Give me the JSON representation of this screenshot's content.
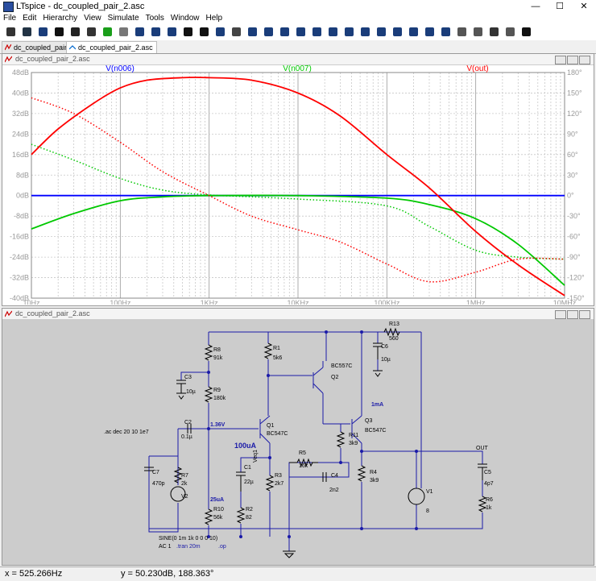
{
  "window": {
    "title": "LTspice - dc_coupled_pair_2.asc",
    "minimize": "—",
    "maximize": "☐",
    "close": "✕"
  },
  "menu": [
    "File",
    "Edit",
    "Hierarchy",
    "View",
    "Simulate",
    "Tools",
    "Window",
    "Help"
  ],
  "toolbar_icons": [
    "settings-icon",
    "open-icon",
    "open-file-icon",
    "save-icon",
    "print-icon",
    "control-panel-icon",
    "run-icon",
    "halt-icon",
    "new-schematic-icon",
    "new-symbol-icon",
    "tile-icon",
    "zoom-in-icon",
    "zoom-out-icon",
    "zoom-fit-icon",
    "autoscale-icon",
    "wire-icon",
    "ground-icon",
    "label-icon",
    "resistor-icon",
    "capacitor-icon",
    "inductor-icon",
    "diode-icon",
    "net-icon",
    "text-icon",
    "spice-directive-icon",
    "move-icon",
    "drag-icon",
    "copy-icon",
    "delete-icon",
    "mirror-icon",
    "undo-icon",
    "redo-icon",
    "find-icon"
  ],
  "tabs": [
    "dc_coupled_pair_2.asc",
    "dc_coupled_pair_2.asc"
  ],
  "plot": {
    "pane_title": "dc_coupled_pair_2.asc",
    "traces": [
      {
        "label": "V(n006)",
        "color": "#0000ff"
      },
      {
        "label": "V(n007)",
        "color": "#00c800"
      },
      {
        "label": "V(out)",
        "color": "#ff0000"
      }
    ],
    "left_ticks": [
      "48dB",
      "40dB",
      "32dB",
      "24dB",
      "16dB",
      "8dB",
      "0dB",
      "-8dB",
      "-16dB",
      "-24dB",
      "-32dB",
      "-40dB"
    ],
    "right_ticks": [
      "180°",
      "150°",
      "120°",
      "90°",
      "60°",
      "30°",
      "0°",
      "-30°",
      "-60°",
      "-90°",
      "-120°",
      "-150°"
    ],
    "x_ticks": [
      "10Hz",
      "100Hz",
      "1KHz",
      "10KHz",
      "100KHz",
      "1MHz",
      "10MHz"
    ]
  },
  "chart_data": {
    "type": "line",
    "x_scale": "log",
    "xlim": [
      "10Hz",
      "10MHz"
    ],
    "ylim_left": [
      -40,
      48
    ],
    "ylim_right": [
      -150,
      180
    ],
    "grid": true,
    "series": [
      {
        "name": "V(n006)",
        "axis": "magnitude (dB)",
        "color": "#0000ff",
        "x": [
          10,
          100,
          1000,
          10000000
        ],
        "y": [
          0,
          0,
          0,
          0
        ]
      },
      {
        "name": "V(n006)",
        "axis": "phase (°)",
        "color": "#0000ff",
        "style": "dotted",
        "x": [
          10,
          100,
          1000,
          10000000
        ],
        "y": [
          0,
          0,
          0,
          0
        ]
      },
      {
        "name": "V(n007)",
        "axis": "magnitude (dB)",
        "color": "#00c800",
        "x": [
          10,
          30,
          100,
          300,
          1000,
          10000,
          100000,
          300000,
          1000000,
          3000000,
          10000000
        ],
        "y": [
          -13,
          -7,
          -2,
          -0.5,
          0,
          0,
          -1,
          -3.5,
          -9,
          -19,
          -35
        ]
      },
      {
        "name": "V(n007)",
        "axis": "phase (°)",
        "color": "#00c800",
        "style": "dotted",
        "x": [
          10,
          30,
          100,
          300,
          1000,
          10000,
          100000,
          300000,
          1000000,
          3000000,
          10000000
        ],
        "y": [
          75,
          52,
          25,
          8,
          1,
          -5,
          -15,
          -45,
          -80,
          -90,
          -93
        ]
      },
      {
        "name": "V(out)",
        "axis": "magnitude (dB)",
        "color": "#ff0000",
        "x": [
          10,
          20,
          50,
          100,
          200,
          500,
          1000,
          3000,
          10000,
          30000,
          100000,
          300000,
          1000000,
          3000000,
          10000000
        ],
        "y": [
          16,
          26,
          36,
          42,
          45,
          46,
          46,
          45,
          40,
          31,
          16,
          3,
          -14,
          -27,
          -39
        ]
      },
      {
        "name": "V(out)",
        "axis": "phase (°)",
        "color": "#ff0000",
        "style": "dotted",
        "x": [
          10,
          30,
          100,
          300,
          1000,
          3000,
          10000,
          30000,
          100000,
          300000,
          1000000,
          3000000,
          10000000
        ],
        "y": [
          143,
          120,
          78,
          35,
          0,
          -30,
          -50,
          -68,
          -100,
          -126,
          -112,
          -93,
          -93
        ]
      }
    ]
  },
  "schematic": {
    "pane_title": "dc_coupled_pair_2.asc",
    "labels": {
      "R13": "R13",
      "R13v": "560",
      "C6": "C6",
      "C6v": "10µ",
      "R8": "R8",
      "R8v": "91k",
      "R1": "R1",
      "R1v": "5k6",
      "C3": "C3",
      "C3v": "10µ",
      "R9": "R9",
      "R9v": "180k",
      "Q2": "Q2",
      "Q2t": "BC557C",
      "Q1": "Q1",
      "Q1t": "BC547C",
      "Q3": "Q3",
      "Q3t": "BC547C",
      "ann1mA": "1mA",
      "C2": "C2",
      "C2v": "0.1µ",
      "ann136": "1.36V",
      "ac": ".ac dec 20 10 1e7",
      "ann100u": "100uA",
      "veq": "Veq1",
      "R11": "R11",
      "R11v": "3k9",
      "R5": "R5",
      "R5v": "16k",
      "C1": "C1",
      "C1v": "22µ",
      "R3": "R3",
      "R3v": "2k7",
      "C4": "C4",
      "C4v": "2n2",
      "R4": "R4",
      "R4v": "3k9",
      "OUT": "OUT",
      "C7": "C7",
      "C7v": "470p",
      "R7": "R7",
      "R7v": "2k",
      "V2": "V2",
      "ann25u": "25uA",
      "R10": "R10",
      "R10v": "56k",
      "R2": "R2",
      "R2v": "82",
      "V1": "V1",
      "V1v": "8",
      "C5": "C5",
      "C5v": "4p7",
      "R6": "R6",
      "R6v": "1k",
      "sine": "SINE(0 1m 1k 0 0 0 10)",
      "ac1": "AC 1",
      "tran": ".tran 20m",
      "op": ".op"
    }
  },
  "status": {
    "x": "x = 525.266Hz",
    "y": "y = 50.230dB, 188.363°"
  }
}
